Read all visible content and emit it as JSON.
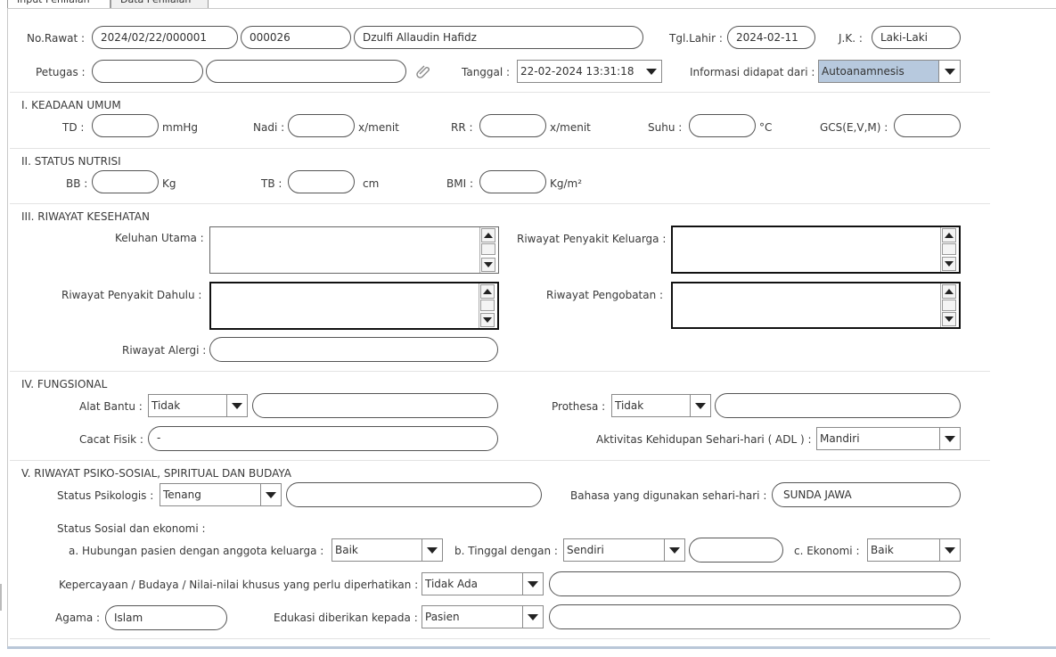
{
  "tabs": [
    {
      "label": "Input Penilaian",
      "active": true
    },
    {
      "label": "Data Penilaian",
      "active": false
    }
  ],
  "header": {
    "no_rawat_label": "No.Rawat :",
    "no_rawat": "2024/02/22/000001",
    "no_rm": "000026",
    "nama_pasien": "Dzulfi Allaudin Hafidz",
    "tgl_lahir_label": "Tgl.Lahir :",
    "tgl_lahir": "2024-02-11",
    "jk_label": "J.K. :",
    "jk": "Laki-Laki",
    "petugas_label": "Petugas :",
    "kd_petugas": "",
    "nm_petugas": "",
    "tanggal_label": "Tanggal :",
    "tanggal": "22-02-2024 13:31:18",
    "informasi_label": "Informasi didapat dari :",
    "informasi": "Autoanamnesis"
  },
  "keadaan_umum": {
    "title": "I. KEADAAN UMUM",
    "td_label": "TD :",
    "td": "",
    "td_unit": "mmHg",
    "nadi_label": "Nadi :",
    "nadi": "",
    "nadi_unit": "x/menit",
    "rr_label": "RR :",
    "rr": "",
    "rr_unit": "x/menit",
    "suhu_label": "Suhu :",
    "suhu": "",
    "suhu_unit": "°C",
    "gcs_label": "GCS(E,V,M) :",
    "gcs": ""
  },
  "status_nutrisi": {
    "title": "II. STATUS NUTRISI",
    "bb_label": "BB :",
    "bb": "",
    "bb_unit": "Kg",
    "tb_label": "TB :",
    "tb": "",
    "tb_unit": "cm",
    "bmi_label": "BMI :",
    "bmi": "",
    "bmi_unit": "Kg/m²"
  },
  "riwayat_kesehatan": {
    "title": "III. RIWAYAT KESEHATAN",
    "keluhan_utama_label": "Keluhan Utama :",
    "rpk_label": "Riwayat Penyakit Keluarga :",
    "rpd_label": "Riwayat Penyakit Dahulu :",
    "rpo_label": "Riwayat Pengobatan :",
    "alergi_label": "Riwayat Alergi :",
    "alergi": ""
  },
  "fungsional": {
    "title": "IV. FUNGSIONAL",
    "alat_bantu_label": "Alat Bantu :",
    "alat_bantu": "Tidak",
    "alat_bantu_ket": "",
    "prothesa_label": "Prothesa :",
    "prothesa": "Tidak",
    "prothesa_ket": "",
    "cacat_fisik_label": "Cacat Fisik :",
    "cacat_fisik": "-",
    "adl_label": "Aktivitas Kehidupan Sehari-hari ( ADL ) :",
    "adl": "Mandiri"
  },
  "psikososial": {
    "title": "V. RIWAYAT PSIKO-SOSIAL, SPIRITUAL DAN BUDAYA",
    "status_psikologis_label": "Status Psikologis :",
    "status_psikologis": "Tenang",
    "status_psikologis_ket": "",
    "bahasa_label": "Bahasa yang digunakan sehari-hari :",
    "bahasa": "SUNDA JAWA",
    "sosial_ekonomi_label": "Status Sosial dan ekonomi :",
    "hubungan_label": "a. Hubungan pasien dengan anggota keluarga :",
    "hubungan": "Baik",
    "tinggal_label": "b. Tinggal dengan :",
    "tinggal": "Sendiri",
    "tinggal_ket": "",
    "ekonomi_label": "c. Ekonomi :",
    "ekonomi": "Baik",
    "kepercayaan_label": "Kepercayaan / Budaya / Nilai-nilai khusus yang perlu diperhatikan :",
    "kepercayaan": "Tidak Ada",
    "kepercayaan_ket": "",
    "agama_label": "Agama :",
    "agama": "Islam",
    "edukasi_label": "Edukasi diberikan kepada :",
    "edukasi": "Pasien",
    "edukasi_ket": ""
  }
}
